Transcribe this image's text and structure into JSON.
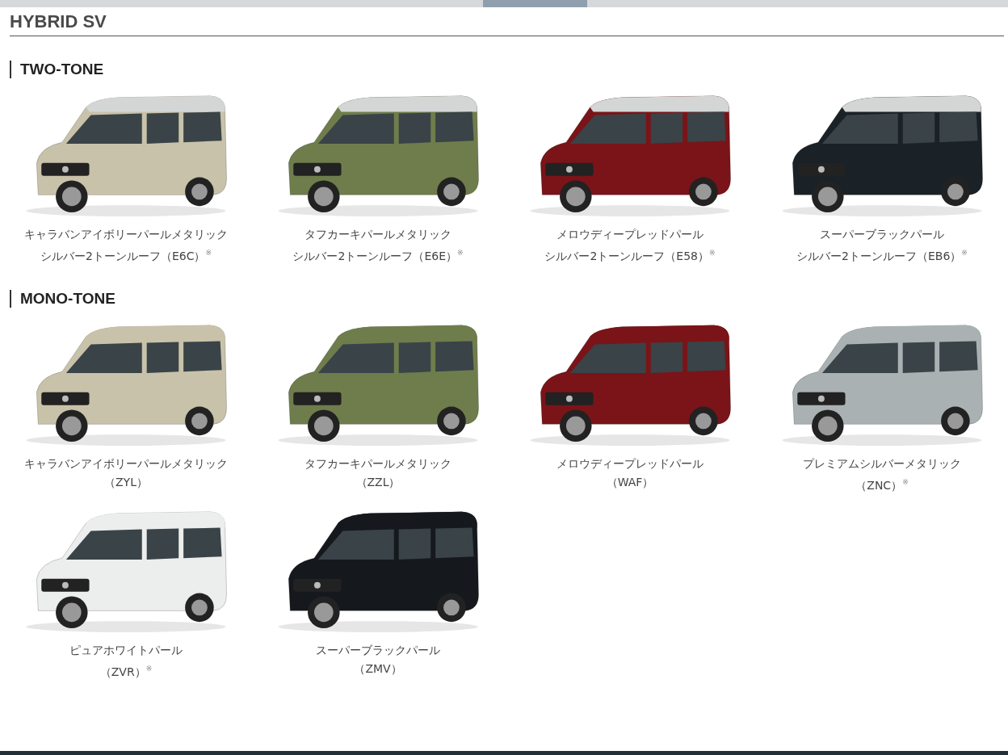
{
  "page_title": "HYBRID SV",
  "sections": [
    {
      "title": "TWO-TONE",
      "kind": "two_tone",
      "cars": [
        {
          "name": "キャラバンアイボリーパールメタリック",
          "code": "シルバー2トーンルーフ（E6C）$^{※}$",
          "color": "#c9c2aa"
        },
        {
          "name": "タフカーキパールメタリック",
          "code": "シルバー2トーンルーフ（E6E）$^{※}$",
          "color": "#6f7d4c"
        },
        {
          "name": "メロウディープレッドパール",
          "code": "シルバー2トーンルーフ（E58）$^{※}$",
          "color": "#7a1418"
        },
        {
          "name": "スーパーブラックパール",
          "code": "シルバー2トーンルーフ（EB6）$^{※}$",
          "color": "#1a2127"
        }
      ]
    },
    {
      "title": "MONO-TONE",
      "kind": "mono_tone",
      "cars": [
        {
          "name": "キャラバンアイボリーパールメタリック",
          "code": "（ZYL）",
          "color": "#c9c2aa"
        },
        {
          "name": "タフカーキパールメタリック",
          "code": "（ZZL）",
          "color": "#6f7d4c"
        },
        {
          "name": "メロウディープレッドパール",
          "code": "（WAF）",
          "color": "#7a1418"
        },
        {
          "name": "プレミアムシルバーメタリック",
          "code": "（ZNC）$^{※}$",
          "color": "#a9b1b3"
        },
        {
          "name": "ピュアホワイトパール",
          "code": "（ZVR）$^{※}$",
          "color": "#eceeee"
        },
        {
          "name": "スーパーブラックパール",
          "code": "（ZMV）",
          "color": "#15191d"
        }
      ]
    }
  ]
}
